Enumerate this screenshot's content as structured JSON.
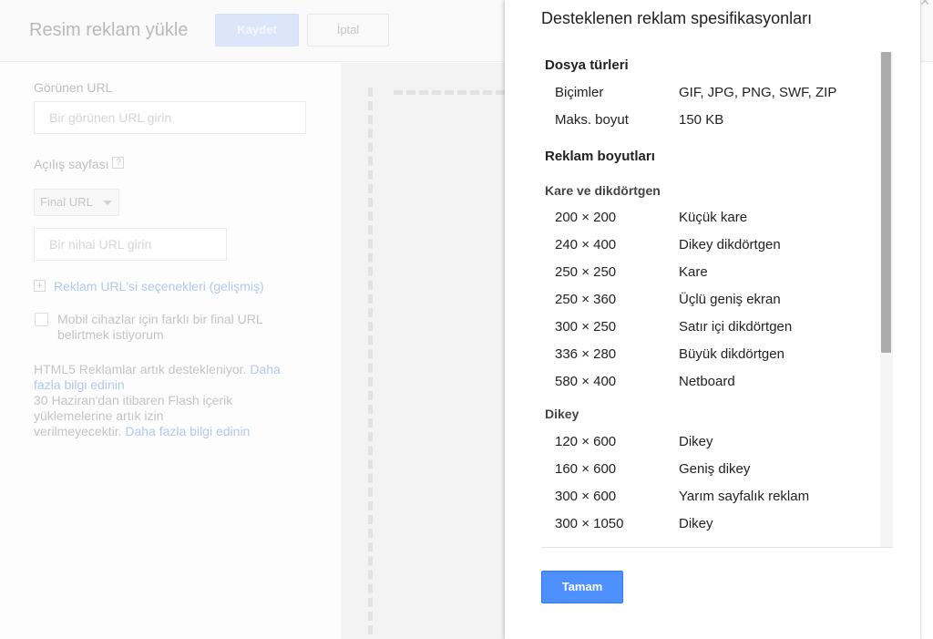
{
  "background": {
    "title": "Resim reklam yükle",
    "save_label": "Kaydet",
    "cancel_label": "İptal",
    "display_url_label": "Görünen URL",
    "display_url_placeholder": "Bir görünen URL girin",
    "landing_page_label": "Açılış sayfası",
    "help_glyph": "?",
    "final_url_select": "Final URL",
    "final_url_placeholder": "Bir nihai URL girin",
    "plus_glyph": "+",
    "ad_url_options_link": "Reklam URL'si seçenekleri (gelişmiş)",
    "mobile_checkbox_line1": "Mobil cihazlar için farklı bir final URL",
    "mobile_checkbox_line2": "belirtmek istiyorum",
    "html5_line1": "HTML5 Reklamlar artık destekleniyor.",
    "html5_link_part1": "Daha",
    "html5_link_part2": "fazla bilgi edinin",
    "flash_line1": "30 Haziran'dan itibaren Flash içerik",
    "flash_line2": "yüklemelerine artık izin",
    "flash_line3": "verilmeyecektir.",
    "flash_link": "Daha fazla bilgi edinin"
  },
  "modal": {
    "title": "Desteklenen reklam spesifikasyonları",
    "close_glyph": "×",
    "file_types_heading": "Dosya türleri",
    "file_types": [
      {
        "label": "Biçimler",
        "value": "GIF, JPG, PNG, SWF, ZIP"
      },
      {
        "label": "Maks. boyut",
        "value": "150 KB"
      }
    ],
    "ad_sizes_heading": "Reklam boyutları",
    "square_heading": "Kare ve dikdörtgen",
    "square_sizes": [
      {
        "size": "200 × 200",
        "name": "Küçük kare"
      },
      {
        "size": "240 × 400",
        "name": "Dikey dikdörtgen"
      },
      {
        "size": "250 × 250",
        "name": "Kare"
      },
      {
        "size": "250 × 360",
        "name": "Üçlü geniş ekran"
      },
      {
        "size": "300 × 250",
        "name": "Satır içi dikdörtgen"
      },
      {
        "size": "336 × 280",
        "name": "Büyük dikdörtgen"
      },
      {
        "size": "580 × 400",
        "name": "Netboard"
      }
    ],
    "vertical_heading": "Dikey",
    "vertical_sizes": [
      {
        "size": "120 × 600",
        "name": "Dikey"
      },
      {
        "size": "160 × 600",
        "name": "Geniş dikey"
      },
      {
        "size": "300 × 600",
        "name": "Yarım sayfalık reklam"
      },
      {
        "size": "300 × 1050",
        "name": "Dikey"
      }
    ],
    "ok_label": "Tamam"
  },
  "colors": {
    "primary_button": "#4d90fe",
    "link_dimmed": "#b3c8f0"
  }
}
